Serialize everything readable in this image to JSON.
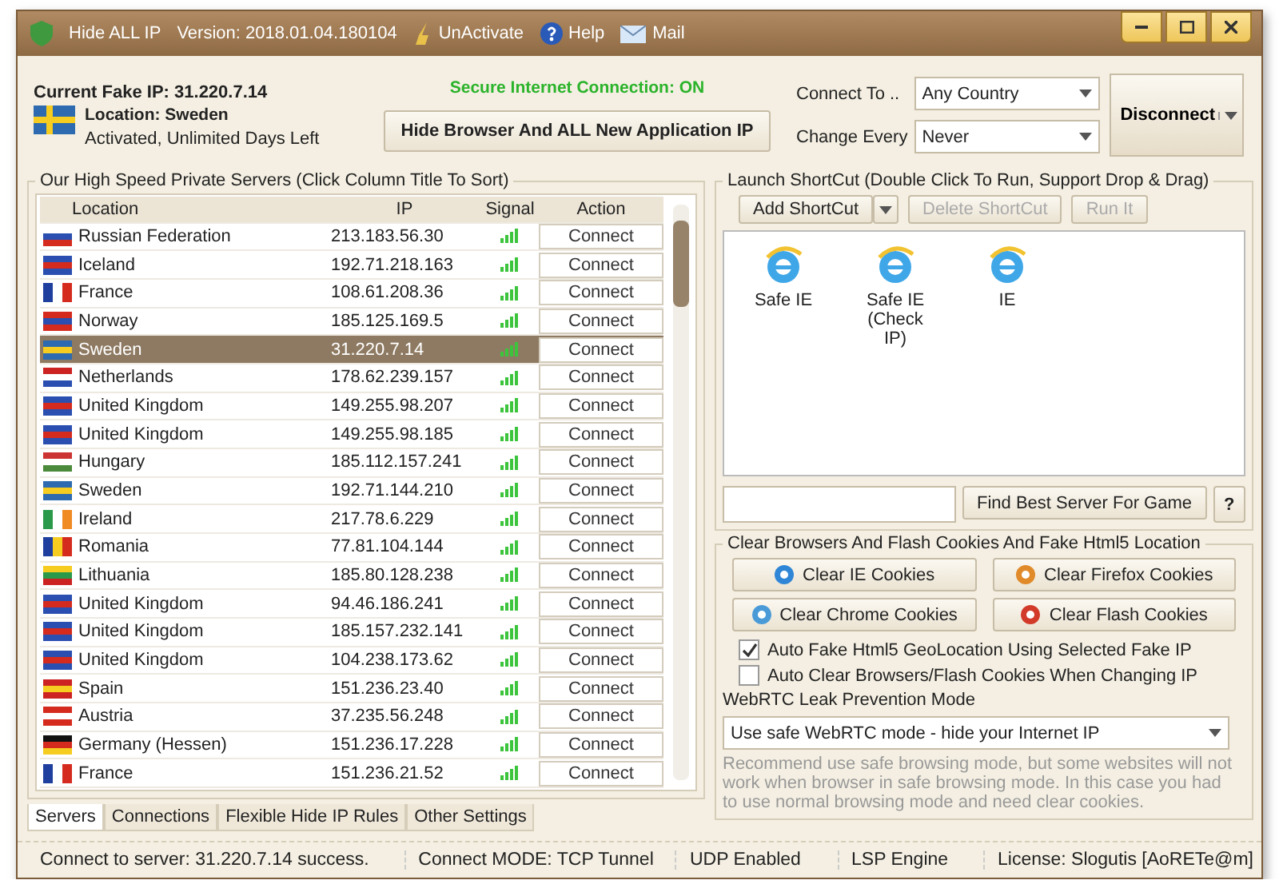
{
  "window": {
    "title": "Hide ALL IP",
    "version": "Version: 2018.01.04.180104",
    "menu": [
      "UnActivate",
      "Help",
      "Mail"
    ]
  },
  "header": {
    "fake_ip": "Current Fake IP: 31.220.7.14",
    "location": "Location: Sweden",
    "activation": "Activated, Unlimited Days Left",
    "secure_status": "Secure Internet Connection: ON",
    "hide_button": "Hide Browser And ALL New Application IP",
    "connect_to_label": "Connect To ..",
    "connect_to": "Any Country",
    "change_every_label": "Change Every",
    "change_every": "Never",
    "disconnect": "Disconnect"
  },
  "servers": {
    "title": "Our High Speed Private Servers (Click Column Title To Sort)",
    "columns": [
      "Location",
      "IP",
      "Signal",
      "Action"
    ],
    "rows": [
      {
        "location": "Russian Federation",
        "ip": "213.183.56.30",
        "action": "Connect",
        "selected": false
      },
      {
        "location": "Iceland",
        "ip": "192.71.218.163",
        "action": "Connect",
        "selected": false
      },
      {
        "location": "France",
        "ip": "108.61.208.36",
        "action": "Connect",
        "selected": false
      },
      {
        "location": "Norway",
        "ip": "185.125.169.5",
        "action": "Connect",
        "selected": false
      },
      {
        "location": "Sweden",
        "ip": "31.220.7.14",
        "action": "Connect",
        "selected": true
      },
      {
        "location": "Netherlands",
        "ip": "178.62.239.157",
        "action": "Connect",
        "selected": false
      },
      {
        "location": "United Kingdom",
        "ip": "149.255.98.207",
        "action": "Connect",
        "selected": false
      },
      {
        "location": "United Kingdom",
        "ip": "149.255.98.185",
        "action": "Connect",
        "selected": false
      },
      {
        "location": "Hungary",
        "ip": "185.112.157.241",
        "action": "Connect",
        "selected": false
      },
      {
        "location": "Sweden",
        "ip": "192.71.144.210",
        "action": "Connect",
        "selected": false
      },
      {
        "location": "Ireland",
        "ip": "217.78.6.229",
        "action": "Connect",
        "selected": false
      },
      {
        "location": "Romania",
        "ip": "77.81.104.144",
        "action": "Connect",
        "selected": false
      },
      {
        "location": "Lithuania",
        "ip": "185.80.128.238",
        "action": "Connect",
        "selected": false
      },
      {
        "location": "United Kingdom",
        "ip": "94.46.186.241",
        "action": "Connect",
        "selected": false
      },
      {
        "location": "United Kingdom",
        "ip": "185.157.232.141",
        "action": "Connect",
        "selected": false
      },
      {
        "location": "United Kingdom",
        "ip": "104.238.173.62",
        "action": "Connect",
        "selected": false
      },
      {
        "location": "Spain",
        "ip": "151.236.23.40",
        "action": "Connect",
        "selected": false
      },
      {
        "location": "Austria",
        "ip": "37.235.56.248",
        "action": "Connect",
        "selected": false
      },
      {
        "location": "Germany (Hessen)",
        "ip": "151.236.17.228",
        "action": "Connect",
        "selected": false
      },
      {
        "location": "France",
        "ip": "151.236.21.52",
        "action": "Connect",
        "selected": false
      }
    ]
  },
  "tabs": [
    {
      "label": "Servers",
      "selected": true
    },
    {
      "label": "Connections",
      "selected": false
    },
    {
      "label": "Flexible Hide IP Rules",
      "selected": false
    },
    {
      "label": "Other Settings",
      "selected": false
    }
  ],
  "shortcuts": {
    "title": "Launch ShortCut (Double Click To Run, Support Drop & Drag)",
    "buttons": [
      {
        "label": "Add ShortCut",
        "disabled": false
      },
      {
        "label": "Delete ShortCut",
        "disabled": true
      },
      {
        "label": "Run It",
        "disabled": true
      }
    ],
    "items": [
      "Safe IE",
      "Safe IE (Check IP)",
      "IE"
    ],
    "find_button": "Find Best Server For Game",
    "help_button": "?"
  },
  "cookies": {
    "title": "Clear Browsers And Flash Cookies And Fake Html5 Location",
    "buttons": [
      "Clear IE Cookies",
      "Clear Firefox Cookies",
      "Clear Chrome Cookies",
      "Clear Flash Cookies"
    ],
    "options": [
      {
        "label": "Auto Fake Html5 GeoLocation Using Selected Fake IP",
        "checked": true
      },
      {
        "label": "Auto Clear Browsers/Flash Cookies When Changing IP",
        "checked": false
      }
    ],
    "webrtc_label": "WebRTC Leak Prevention Mode",
    "webrtc_mode": "Use safe WebRTC mode - hide your Internet IP",
    "note": "Recommend use safe browsing mode, but some websites will not work when browser in safe browsing mode. In this case you had to use normal browsing mode and need clear cookies."
  },
  "status_bar": [
    "Connect to server: 31.220.7.14 success.",
    "Connect MODE: TCP Tunnel",
    "UDP Enabled",
    "LSP Engine",
    "License: Slogutis [AoRETe@m]"
  ]
}
